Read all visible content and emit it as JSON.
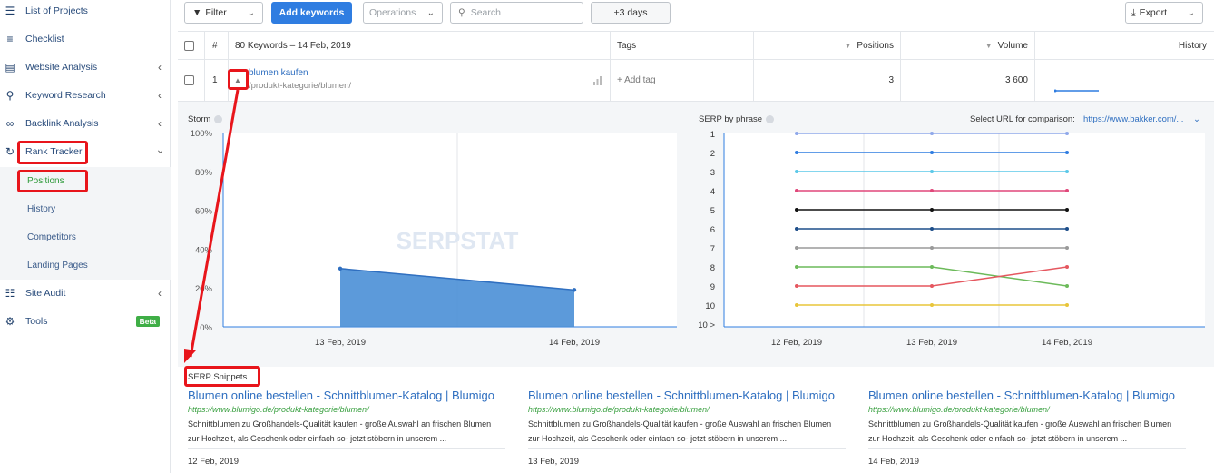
{
  "sidebar": {
    "items": [
      {
        "label": "List of Projects",
        "icon": "layers-icon"
      },
      {
        "label": "Checklist",
        "icon": "list-icon"
      },
      {
        "label": "Website Analysis",
        "icon": "analysis-icon"
      },
      {
        "label": "Keyword Research",
        "icon": "key-icon"
      },
      {
        "label": "Backlink Analysis",
        "icon": "link-icon"
      },
      {
        "label": "Rank Tracker",
        "icon": "history-icon"
      },
      {
        "label": "Site Audit",
        "icon": "sitemap-icon"
      },
      {
        "label": "Tools",
        "icon": "gear-icon"
      }
    ],
    "rank_tracker_sub": [
      "Positions",
      "History",
      "Competitors",
      "Landing Pages"
    ],
    "tools_badge": "Beta"
  },
  "toolbar": {
    "filter_label": "Filter",
    "add_keywords_label": "Add keywords",
    "operations_placeholder": "Operations",
    "search_placeholder": "Search",
    "days_label": "+3 days",
    "export_label": "Export"
  },
  "table": {
    "header": {
      "index": "#",
      "keywords": "80 Keywords – 14 Feb, 2019",
      "tags": "Tags",
      "positions": "Positions",
      "volume": "Volume",
      "history": "History"
    },
    "row": {
      "index": "1",
      "keyword": "blumen kaufen",
      "url": "/produkt-kategorie/blumen/",
      "tag": "+ Add tag",
      "position": "3",
      "volume": "3 600"
    }
  },
  "storm": {
    "title": "Storm",
    "watermark": "SERPSTAT"
  },
  "serp_phrase": {
    "title": "SERP by phrase",
    "compare_label": "Select URL for comparison:",
    "compare_url": "https://www.bakker.com/..."
  },
  "chart_data": [
    {
      "type": "area",
      "title": "Storm",
      "x_ticks": [
        "13 Feb, 2019",
        "14 Feb, 2019"
      ],
      "y_ticks": [
        "100%",
        "80%",
        "60%",
        "40%",
        "20%",
        "0%"
      ],
      "ylim": [
        0,
        100
      ],
      "series": [
        {
          "x": [
            "13 Feb, 2019",
            "14 Feb, 2019"
          ],
          "values": [
            30,
            19
          ]
        }
      ],
      "color": "#4a8fd6"
    },
    {
      "type": "line",
      "title": "SERP by phrase",
      "categories": [
        "12 Feb, 2019",
        "13 Feb, 2019",
        "14 Feb, 2019"
      ],
      "y_ticks": [
        "1",
        "2",
        "3",
        "4",
        "5",
        "6",
        "7",
        "8",
        "9",
        "10",
        "10 >"
      ],
      "ylim": [
        1,
        11
      ],
      "series": [
        {
          "values": [
            1,
            1,
            1
          ],
          "color": "#8fa8ea"
        },
        {
          "values": [
            2,
            2,
            2
          ],
          "color": "#2f7de1"
        },
        {
          "values": [
            3,
            3,
            3
          ],
          "color": "#5bc8e8"
        },
        {
          "values": [
            4,
            4,
            4
          ],
          "color": "#e0477a"
        },
        {
          "values": [
            5,
            5,
            5
          ],
          "color": "#111111"
        },
        {
          "values": [
            6,
            6,
            6
          ],
          "color": "#1d4e8a"
        },
        {
          "values": [
            7,
            7,
            7
          ],
          "color": "#9a9a9a"
        },
        {
          "values": [
            8,
            8,
            9
          ],
          "color": "#6cba5a"
        },
        {
          "values": [
            9,
            9,
            8
          ],
          "color": "#e5575f"
        },
        {
          "values": [
            10,
            10,
            10
          ],
          "color": "#e8c53a"
        }
      ]
    }
  ],
  "serp_snippets": {
    "title": "SERP Snippets",
    "items": [
      {
        "title": "Blumen online bestellen - Schnittblumen-Katalog | Blumigo",
        "url": "https://www.blumigo.de/produkt-kategorie/blumen/",
        "desc1": "Schnittblumen zu Großhandels-Qualität kaufen - große Auswahl an frischen Blumen",
        "desc2": "zur Hochzeit, als Geschenk oder einfach so- jetzt stöbern in unserem ...",
        "date": "12 Feb, 2019"
      },
      {
        "title": "Blumen online bestellen - Schnittblumen-Katalog | Blumigo",
        "url": "https://www.blumigo.de/produkt-kategorie/blumen/",
        "desc1": "Schnittblumen zu Großhandels-Qualität kaufen - große Auswahl an frischen Blumen",
        "desc2": "zur Hochzeit, als Geschenk oder einfach so- jetzt stöbern in unserem ...",
        "date": "13 Feb, 2019"
      },
      {
        "title": "Blumen online bestellen - Schnittblumen-Katalog | Blumigo",
        "url": "https://www.blumigo.de/produkt-kategorie/blumen/",
        "desc1": "Schnittblumen zu Großhandels-Qualität kaufen - große Auswahl an frischen Blumen",
        "desc2": "zur Hochzeit, als Geschenk oder einfach so- jetzt stöbern in unserem ...",
        "date": "14 Feb, 2019"
      }
    ]
  },
  "colors": {
    "accent": "#2f7de1",
    "highlight": "#e8151b",
    "snippet_url": "#3aa041"
  }
}
